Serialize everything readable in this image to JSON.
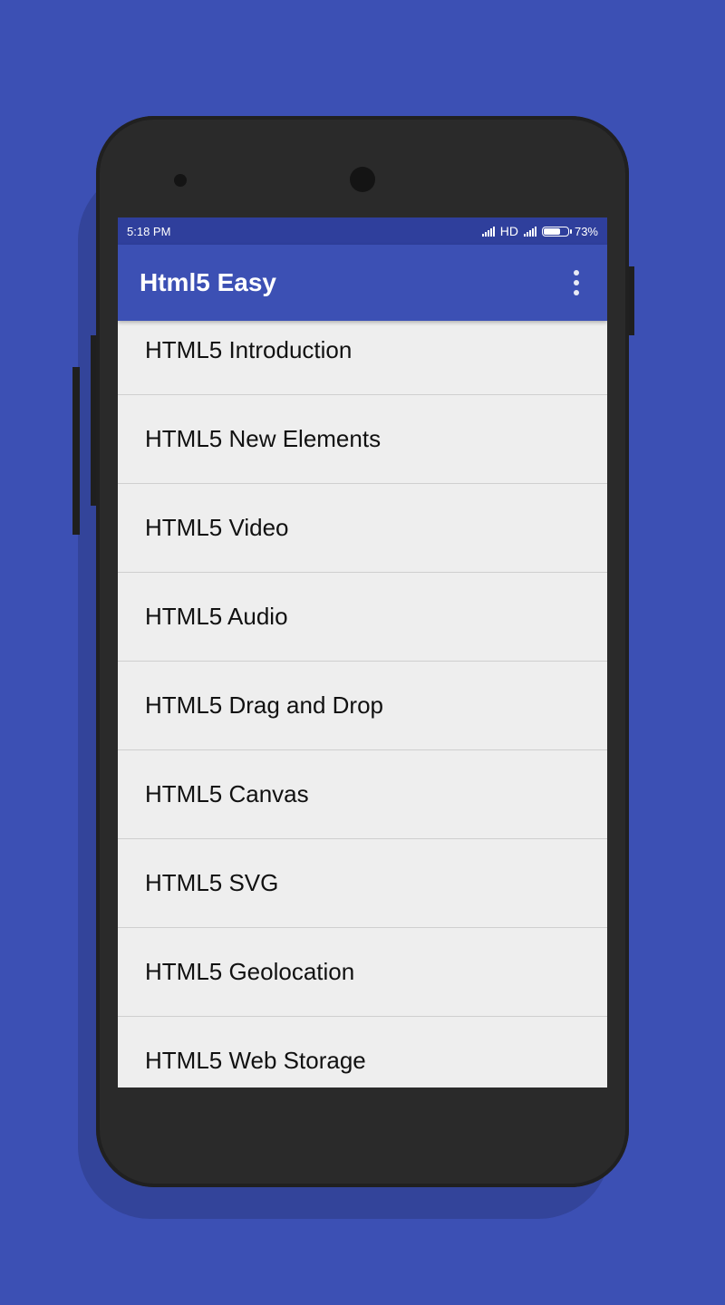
{
  "status_bar": {
    "time": "5:18 PM",
    "network": "HD",
    "battery_percent": "73%",
    "battery_level": 0.73,
    "icons": [
      "signal-icon",
      "signal-icon",
      "battery-icon"
    ]
  },
  "app_bar": {
    "title": "Html5 Easy",
    "menu_icon": "more-vert-icon"
  },
  "topics": [
    {
      "label": "HTML5 Introduction"
    },
    {
      "label": "HTML5 New Elements"
    },
    {
      "label": "HTML5 Video"
    },
    {
      "label": "HTML5 Audio"
    },
    {
      "label": "HTML5 Drag and Drop"
    },
    {
      "label": "HTML5 Canvas"
    },
    {
      "label": "HTML5 SVG"
    },
    {
      "label": "HTML5 Geolocation"
    },
    {
      "label": "HTML5 Web Storage"
    }
  ],
  "colors": {
    "background": "#3c50b4",
    "primary": "#3c50b4",
    "primary_dark": "#2f3f9c",
    "list_background": "#eeeeee",
    "phone_body": "#2a2a2a"
  }
}
